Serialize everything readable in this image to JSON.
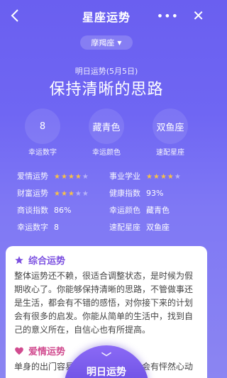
{
  "header": {
    "title": "星座运势",
    "more": "•••",
    "close": "✕"
  },
  "sign_selector": {
    "label": "摩羯座"
  },
  "forecast": {
    "date_label": "明日运势(5月5日)",
    "headline": "保持清晰的思路"
  },
  "lucky": [
    {
      "value": "8",
      "label": "幸运数字"
    },
    {
      "value": "藏青色",
      "label": "幸运颜色"
    },
    {
      "value": "双鱼座",
      "label": "速配星座"
    }
  ],
  "stats": [
    {
      "k": "爱情运势",
      "stars": 4,
      "k2": "事业学业",
      "stars2": 4
    },
    {
      "k": "财富运势",
      "stars": 3,
      "k2": "健康指数",
      "v2": "93%"
    },
    {
      "k": "商谈指数",
      "v": "86%",
      "k2": "幸运颜色",
      "v2": "藏青色"
    },
    {
      "k": "幸运数字",
      "v": "8",
      "k2": "速配星座",
      "v2": "双鱼座"
    }
  ],
  "card": {
    "section1_title": "综合运势",
    "section1_text": "整体运势还不赖，很适合调整状态，是时候为假期收心了。你能够保持清晰的思路，不管做事还是生活，都会有不错的感悟，对你接下来的计划会有很多的启发。你能从简单的生活中，找到自己的意义所在，自信心也有所提高。",
    "section2_title": "爱情运势",
    "section2_text": "单身的出门容易遇到心仪的对象，会有怦然心动"
  },
  "fab": {
    "label": "明日运势"
  },
  "colors": {
    "accent": "#7b4fe0",
    "star": "#f6c04a",
    "bg_top": "#6a5ff0"
  }
}
